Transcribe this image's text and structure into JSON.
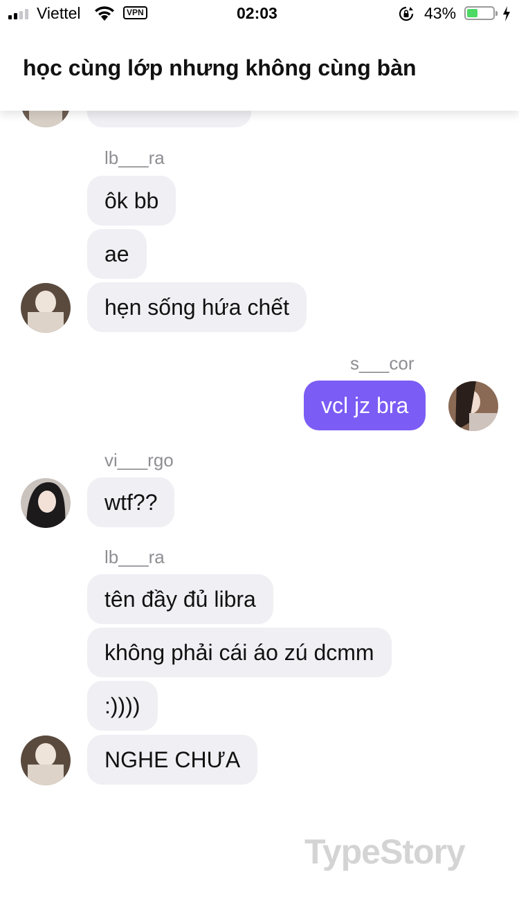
{
  "status_bar": {
    "carrier": "Viettel",
    "vpn": "VPN",
    "time": "02:03",
    "battery_percent": "43%",
    "battery_level": 0.43,
    "signal_bars_active": 2,
    "signal_bars_total": 4
  },
  "header": {
    "title": "học cùng lớp nhưng không cùng bàn"
  },
  "messages": [
    {
      "sender": "lb___ra"
    },
    {
      "text": "ôk bb"
    },
    {
      "text": "ae"
    },
    {
      "text": "hẹn sống hứa chết"
    },
    {
      "sender": "s___cor",
      "text": "vcl jz bra"
    },
    {
      "sender": "vi___rgo",
      "text": "wtf??"
    },
    {
      "sender": "lb___ra"
    },
    {
      "text": "tên đầy đủ libra"
    },
    {
      "text": "không phải cái áo zú dcmm"
    },
    {
      "text": ":))))"
    },
    {
      "text": "NGHE CHƯA"
    }
  ],
  "watermark": "TypeStory",
  "colors": {
    "incoming_bubble": "#efeff4",
    "outgoing_bubble": "#7b5cf5",
    "sender_name": "#8e8e93",
    "battery_fill": "#4cd964"
  }
}
